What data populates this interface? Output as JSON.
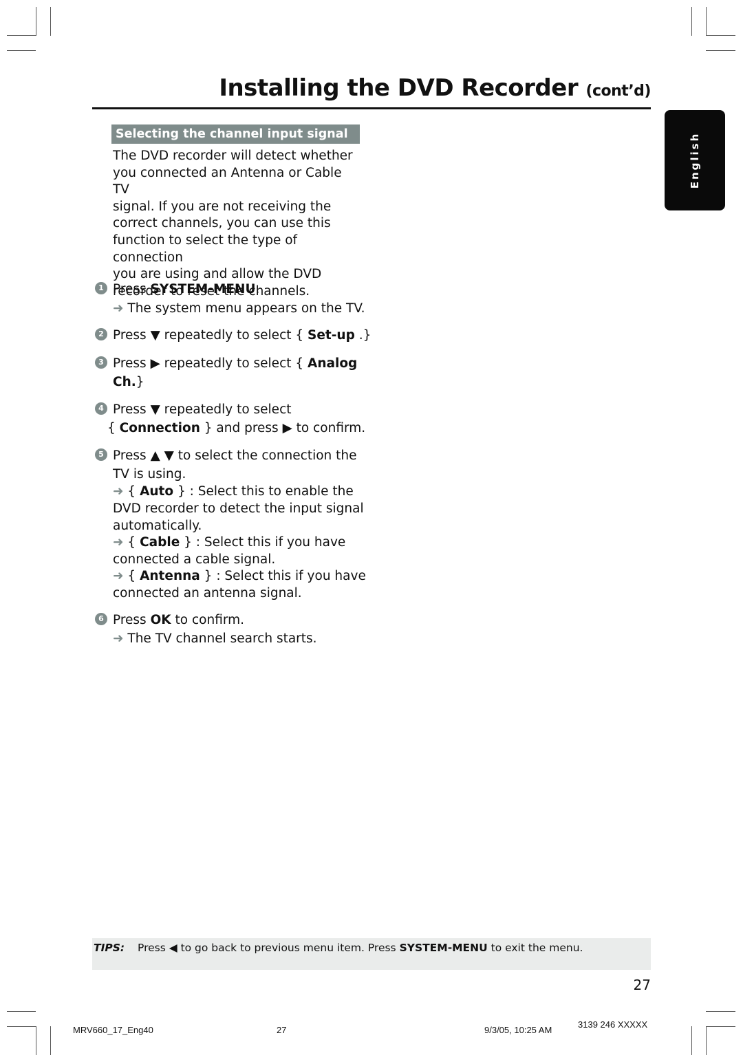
{
  "header": {
    "title": "Installing the DVD Recorder",
    "title_suffix": "(cont’d)"
  },
  "language_tab": "English",
  "section": {
    "heading": "Selecting the channel input signal",
    "intro": [
      "The DVD recorder will detect whether",
      "you connected an Antenna or Cable TV",
      "signal.  If you are not receiving the",
      "correct channels, you can use this",
      "function to select the type of connection",
      "you are using and allow the DVD",
      "recorder to reset the channels."
    ]
  },
  "steps": [
    {
      "number": "1",
      "pre": "Press ",
      "bold": "SYSTEM-MENU",
      "post": ".",
      "result": "The system menu appears on the TV."
    },
    {
      "number": "2",
      "pre": "Press ▼ repeatedly to select { ",
      "bold": "Set-up",
      "post": " .}"
    },
    {
      "number": "3",
      "pre": "Press ▶ repeatedly to select { ",
      "bold": "Analog",
      "line2_bold": "Ch.",
      "line2_post": "}"
    },
    {
      "number": "4",
      "pre": "Press ▼ repeatedly to select",
      "line2_pre": "{ ",
      "line2_bold": "Connection",
      "line2_post": " } and press ▶ to confirm."
    },
    {
      "number": "5",
      "pre": "Press ▲ ▼ to select the connection the",
      "line2": "TV is using.",
      "options": [
        {
          "name": "Auto",
          "desc": " : Select this to enable the",
          "desc2": "DVD recorder to detect the input signal",
          "desc3": "automatically."
        },
        {
          "name": "Cable",
          "desc": " : Select this if you have",
          "desc2": "connected a cable signal."
        },
        {
          "name": "Antenna",
          "desc": " : Select this if you have",
          "desc2": "connected an antenna signal."
        }
      ]
    },
    {
      "number": "6",
      "pre": "Press ",
      "bold": "OK",
      "post": " to confirm.",
      "result": "The TV channel search starts."
    }
  ],
  "tips": {
    "label": "TIPS:",
    "pre": "Press ◀ to go back to previous menu item.  Press ",
    "bold": "SYSTEM-MENU",
    "post": " to exit the menu."
  },
  "page_number": "27",
  "footer": {
    "file": "MRV660_17_Eng40",
    "page": "27",
    "datetime": "9/3/05, 10:25 AM",
    "code": "3139 246 XXXXX"
  },
  "arrow_glyph": "➜"
}
